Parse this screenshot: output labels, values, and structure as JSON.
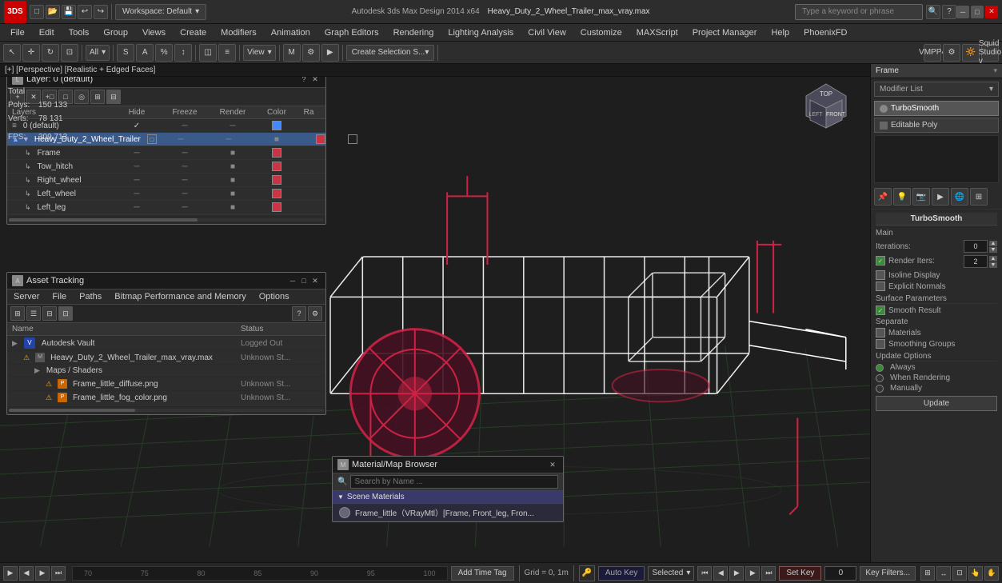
{
  "titlebar": {
    "logo": "3DS",
    "workspace": "Workspace: Default",
    "filename": "Autodesk 3ds Max Design 2014 x64",
    "openfile": "Heavy_Duty_2_Wheel_Trailer_max_vray.max",
    "search_placeholder": "Type a keyword or phrase",
    "win_min": "─",
    "win_max": "□",
    "win_close": "✕"
  },
  "menubar": {
    "items": [
      "File",
      "Edit",
      "Tools",
      "Group",
      "Views",
      "Create",
      "Modifiers",
      "Animation",
      "Graph Editors",
      "Rendering",
      "Lighting Analysis",
      "Civil View",
      "Customize",
      "MAXScript",
      "Project Manager",
      "Help",
      "PhoenixFD"
    ]
  },
  "toolbar": {
    "mode_label": "All",
    "view_label": "View",
    "selection_label": "Create Selection S..."
  },
  "viewport": {
    "header": "[+] [Perspective] [Realistic + Edged Faces]",
    "stats_total": "Total",
    "stats_polys": "Polys:",
    "stats_polys_val": "150 133",
    "stats_verts": "Verts:",
    "stats_verts_val": "78 131",
    "stats_fps": "FPS:",
    "stats_fps_val": "309,713"
  },
  "layer_panel": {
    "title": "Layer: 0 (default)",
    "help": "?",
    "close": "✕",
    "columns": [
      "Layers",
      "Hide",
      "Freeze",
      "Render",
      "Color",
      "Ra"
    ],
    "rows": [
      {
        "name": "0 (default)",
        "indent": false,
        "check": true,
        "hide": "─",
        "freeze": "─",
        "render": "─",
        "color": "#4488ff",
        "ra": ""
      },
      {
        "name": "Heavy_Duty_2_Wheel_Trailer",
        "indent": false,
        "check": false,
        "hide": "─",
        "freeze": "─",
        "render": "■",
        "color": "#cc3344",
        "ra": "□"
      },
      {
        "name": "Frame",
        "indent": true,
        "check": false,
        "hide": "─",
        "freeze": "─",
        "render": "■",
        "color": "#cc3344",
        "ra": ""
      },
      {
        "name": "Tow_hitch",
        "indent": true,
        "check": false,
        "hide": "─",
        "freeze": "─",
        "render": "■",
        "color": "#cc3344",
        "ra": ""
      },
      {
        "name": "Right_wheel",
        "indent": true,
        "check": false,
        "hide": "─",
        "freeze": "─",
        "render": "■",
        "color": "#cc3344",
        "ra": ""
      },
      {
        "name": "Left_wheel",
        "indent": true,
        "check": false,
        "hide": "─",
        "freeze": "─",
        "render": "■",
        "color": "#cc3344",
        "ra": ""
      },
      {
        "name": "Left_leg",
        "indent": true,
        "check": false,
        "hide": "─",
        "freeze": "─",
        "render": "■",
        "color": "#cc3344",
        "ra": ""
      }
    ]
  },
  "asset_panel": {
    "title": "Asset Tracking",
    "min": "─",
    "max": "□",
    "close": "✕",
    "menu": [
      "Server",
      "File",
      "Paths",
      "Bitmap Performance and Memory",
      "Options"
    ],
    "columns": [
      "Name",
      "Status"
    ],
    "rows": [
      {
        "name": "Autodesk Vault",
        "type": "vault",
        "status": "Logged Out",
        "indent": 0
      },
      {
        "name": "Heavy_Duty_2_Wheel_Trailer_max_vray.max",
        "type": "warning",
        "status": "Unknown St...",
        "indent": 1
      },
      {
        "name": "Maps / Shaders",
        "type": "folder",
        "status": "",
        "indent": 2
      },
      {
        "name": "Frame_little_diffuse.png",
        "type": "image",
        "status": "Unknown St...",
        "indent": 3
      },
      {
        "name": "Frame_little_fog_color.png",
        "type": "image",
        "status": "Unknown St...",
        "indent": 3
      }
    ]
  },
  "material_panel": {
    "title": "Material/Map Browser",
    "close": "✕",
    "search_placeholder": "Search by Name ...",
    "scene_materials_label": "Scene Materials",
    "mat_item": "Frame_little（VRayMtl）[Frame, Front_leg, Fron..."
  },
  "right_panel": {
    "frame_label": "Frame",
    "modifier_list_label": "Modifier List",
    "modifiers": [
      {
        "name": "TurboSmooth",
        "selected": true
      },
      {
        "name": "Editable Poly",
        "selected": false
      }
    ],
    "turbosmooth": {
      "title": "TurboSmooth",
      "main_label": "Main",
      "iterations_label": "Iterations:",
      "iterations_val": "0",
      "render_iters_label": "Render Iters:",
      "render_iters_val": "2",
      "render_iters_checked": true,
      "isoline_label": "Isoline Display",
      "explicit_label": "Explicit Normals",
      "surface_label": "Surface Parameters",
      "smooth_label": "Smooth Result",
      "smooth_checked": true,
      "separate_label": "Separate",
      "materials_label": "Materials",
      "materials_checked": false,
      "smoothing_label": "Smoothing Groups",
      "smoothing_checked": false,
      "update_label": "Update Options",
      "always_label": "Always",
      "always_checked": true,
      "when_rendering_label": "When Rendering",
      "when_rendering_checked": false,
      "manually_label": "Manually",
      "manually_checked": false,
      "update_btn": "Update"
    }
  },
  "statusbar": {
    "grid_label": "Grid = 0, 1m",
    "auto_key_label": "Auto Key",
    "selected_label": "Selected",
    "set_key_label": "Set Key",
    "key_filters_label": "Key Filters...",
    "frame_val": "0"
  },
  "timeline": {
    "markers": [
      "70",
      "75",
      "80",
      "85",
      "90",
      "95",
      "100"
    ]
  },
  "colors": {
    "accent_red": "#cc3344",
    "accent_blue": "#4488ff",
    "bg_dark": "#1a1a1a",
    "bg_panel": "#2d2d2d",
    "bg_toolbar": "#2a2a2a"
  }
}
